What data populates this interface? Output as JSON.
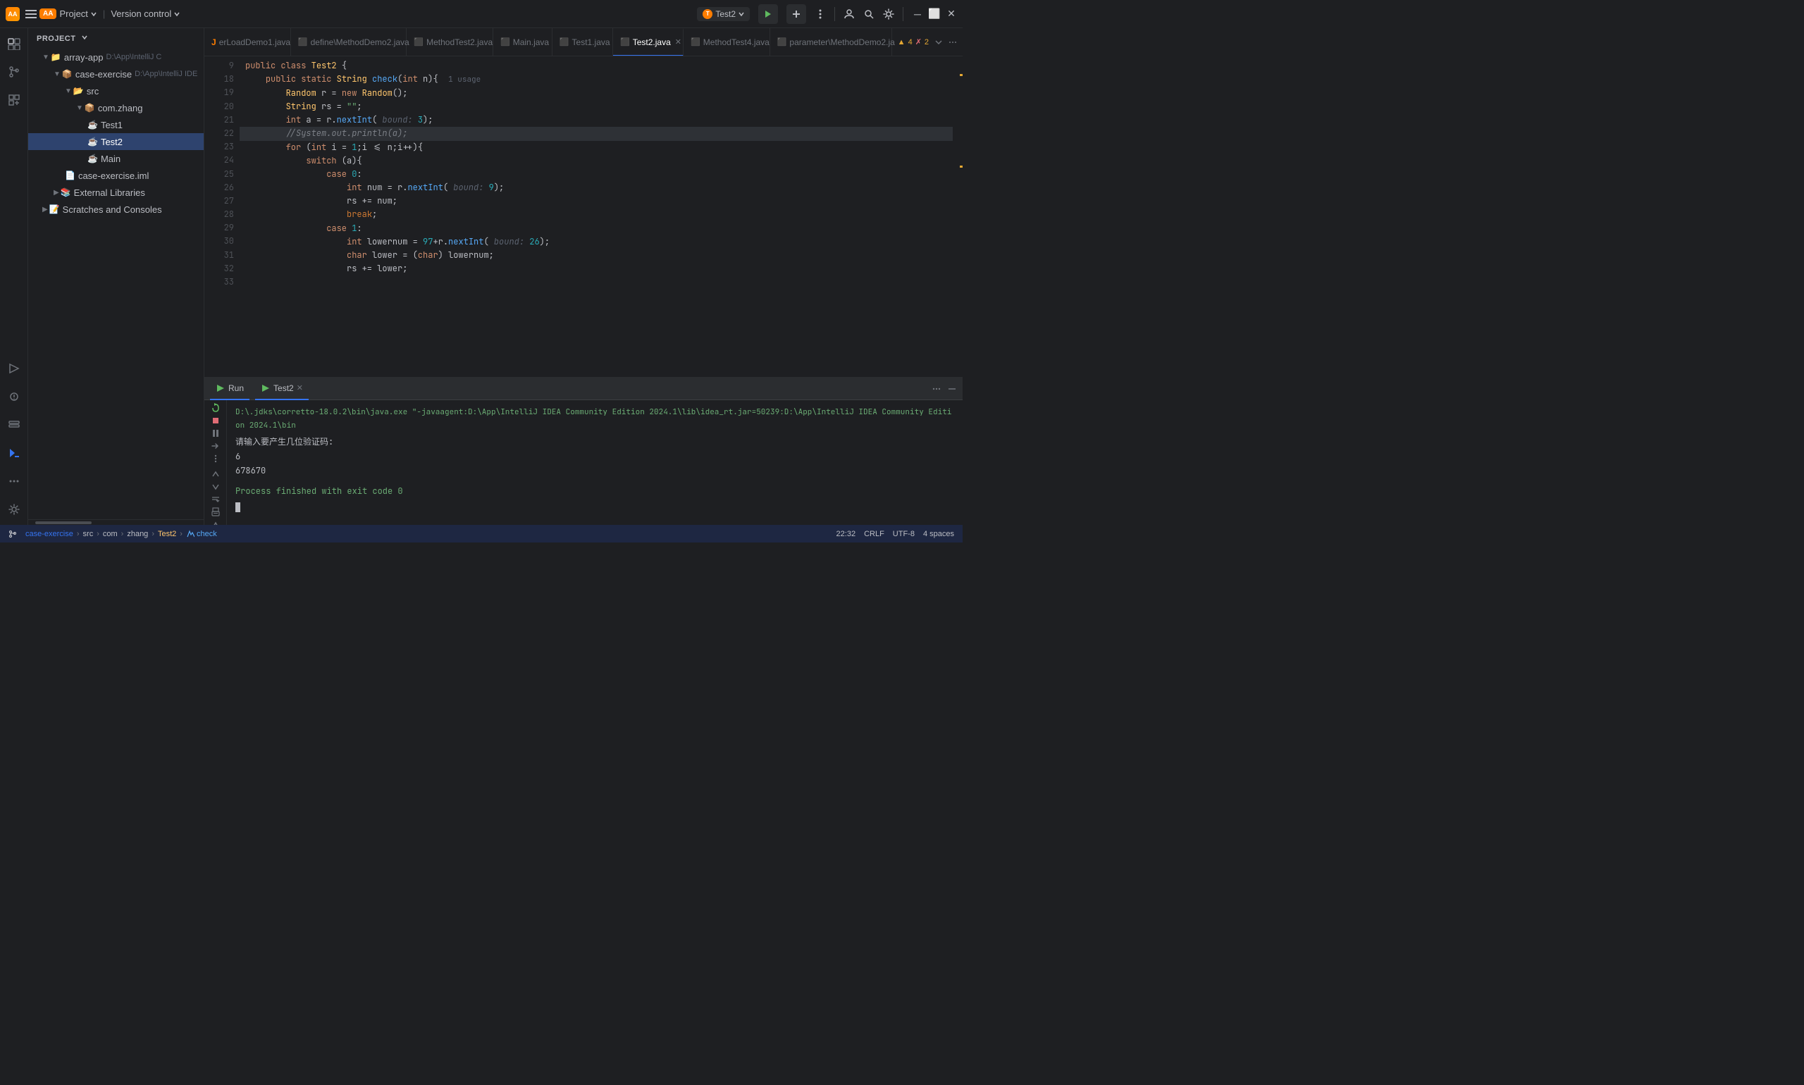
{
  "titleBar": {
    "appName": "AA",
    "projectName": "array-app",
    "versionControl": "Version control",
    "runConfig": "Test2",
    "icons": [
      "hamburger",
      "run-green",
      "build",
      "more-vert",
      "account",
      "search",
      "settings",
      "minimize",
      "maximize",
      "close"
    ]
  },
  "sidebar": {
    "header": "Project",
    "items": [
      {
        "level": 1,
        "label": "array-app",
        "path": "D:\\App\\IntelliJ C",
        "type": "folder",
        "expanded": true
      },
      {
        "level": 2,
        "label": "case-exercise",
        "path": "D:\\App\\IntelliJ IDE",
        "type": "folder",
        "expanded": true
      },
      {
        "level": 3,
        "label": "src",
        "type": "folder",
        "expanded": true
      },
      {
        "level": 4,
        "label": "com.zhang",
        "type": "package",
        "expanded": true
      },
      {
        "level": 5,
        "label": "Test1",
        "type": "java"
      },
      {
        "level": 5,
        "label": "Test2",
        "type": "java",
        "selected": true
      },
      {
        "level": 5,
        "label": "Main",
        "type": "java"
      },
      {
        "level": 3,
        "label": "case-exercise.iml",
        "type": "iml"
      },
      {
        "level": 2,
        "label": "External Libraries",
        "type": "folder"
      },
      {
        "level": 1,
        "label": "Scratches and Consoles",
        "type": "scratches"
      }
    ]
  },
  "tabs": [
    {
      "id": "overload",
      "label": "erLoadDemo1.java",
      "icon": "J",
      "active": false,
      "modified": false
    },
    {
      "id": "define",
      "label": "define\\MethodDemo2.java",
      "icon": "J",
      "active": false,
      "modified": false
    },
    {
      "id": "methodtest2",
      "label": "MethodTest2.java",
      "icon": "J",
      "active": false,
      "modified": false
    },
    {
      "id": "main",
      "label": "Main.java",
      "icon": "J",
      "active": false,
      "modified": false
    },
    {
      "id": "test1",
      "label": "Test1.java",
      "icon": "J",
      "active": false,
      "modified": false
    },
    {
      "id": "test2",
      "label": "Test2.java",
      "icon": "J",
      "active": true,
      "modified": false
    },
    {
      "id": "method4",
      "label": "MethodTest4.java",
      "icon": "J",
      "active": false,
      "modified": false
    },
    {
      "id": "param",
      "label": "parameter\\MethodDemo2.ja",
      "icon": "J",
      "active": false,
      "modified": false
    }
  ],
  "editor": {
    "warnings": "▲ 4  ✗ 2",
    "lines": [
      {
        "num": 9,
        "content": "public class Test2 {",
        "type": "code"
      },
      {
        "num": 18,
        "content": "    public static String check(int n){  1 usage",
        "type": "code"
      },
      {
        "num": 19,
        "content": "        Random r = new Random();",
        "type": "code"
      },
      {
        "num": 20,
        "content": "        String rs = \"\";",
        "type": "code"
      },
      {
        "num": 21,
        "content": "        int a = r.nextInt( bound: 3);",
        "type": "code"
      },
      {
        "num": 22,
        "content": "        //System.out.println(a);",
        "type": "code",
        "highlighted": true
      },
      {
        "num": 23,
        "content": "",
        "type": "code"
      },
      {
        "num": 24,
        "content": "        for (int i = 1;i <= n;i++){",
        "type": "code"
      },
      {
        "num": 25,
        "content": "            switch (a){",
        "type": "code"
      },
      {
        "num": 26,
        "content": "                case 0:",
        "type": "code"
      },
      {
        "num": 27,
        "content": "                    int num = r.nextInt( bound: 9);",
        "type": "code"
      },
      {
        "num": 28,
        "content": "                    rs += num;",
        "type": "code"
      },
      {
        "num": 29,
        "content": "                    break;",
        "type": "code"
      },
      {
        "num": 30,
        "content": "                case 1:",
        "type": "code"
      },
      {
        "num": 31,
        "content": "                    int lowernum = 97+r.nextInt( bound: 26);",
        "type": "code"
      },
      {
        "num": 32,
        "content": "                    char lower = (char) lowernum;",
        "type": "code"
      },
      {
        "num": 33,
        "content": "                    rs += lower;",
        "type": "code"
      }
    ]
  },
  "runPanel": {
    "title": "Run",
    "activeTab": "Test2",
    "cmd": "D:\\.jdks\\corretto-18.0.2\\bin\\java.exe \"-javaagent:D:\\App\\IntelliJ IDEA Community Edition 2024.1\\lib\\idea_rt.jar=50239:D:\\App\\IntelliJ IDEA Community Edition 2024.1\\bin",
    "prompt": "请输入要产生几位验证码:",
    "line1": "6",
    "line2": "678670",
    "exit": "Process finished with exit code 0"
  },
  "statusBar": {
    "branch": "case-exercise",
    "path1": "src",
    "path2": "com",
    "path3": "zhang",
    "path4": "Test2",
    "path5": "check",
    "position": "22:32",
    "lineEnding": "CRLF",
    "encoding": "UTF-8",
    "indent": "4 spaces"
  },
  "activityBar": {
    "icons": [
      "folders",
      "git",
      "plugins",
      "run",
      "debug",
      "services",
      "terminal",
      "settings-bottom"
    ]
  }
}
